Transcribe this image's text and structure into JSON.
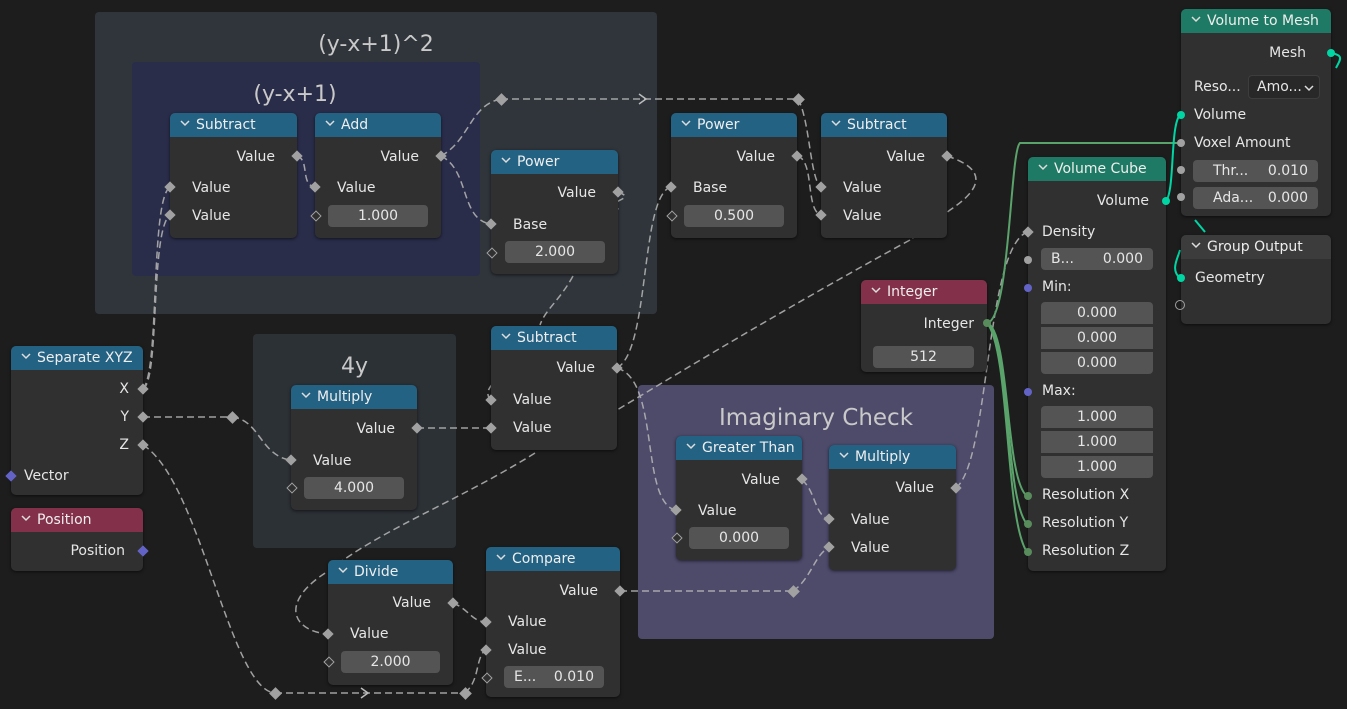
{
  "frames": {
    "outer_square": {
      "title": "(y-x+1)^2",
      "color": "#2f353b"
    },
    "inner_linear": {
      "title": "(y-x+1)",
      "color": "#2a2d4a"
    },
    "four_y": {
      "title": "4y",
      "color": "#2c3136"
    },
    "imaginary": {
      "title": "Imaginary Check",
      "color": "#4d4a6a"
    }
  },
  "nodes": {
    "subtract1": {
      "title": "Subtract",
      "out": "Value",
      "in1": "Value",
      "in2": "Value"
    },
    "add": {
      "title": "Add",
      "out": "Value",
      "in1": "Value",
      "in2_value": "1.000"
    },
    "power1": {
      "title": "Power",
      "out": "Value",
      "in1": "Base",
      "in2_value": "2.000"
    },
    "power2": {
      "title": "Power",
      "out": "Value",
      "in1": "Base",
      "in2_value": "0.500"
    },
    "subtract2": {
      "title": "Subtract",
      "out": "Value",
      "in1": "Value",
      "in2": "Value"
    },
    "subtract3": {
      "title": "Subtract",
      "out": "Value",
      "in1": "Value",
      "in2": "Value"
    },
    "multiply1": {
      "title": "Multiply",
      "out": "Value",
      "in1": "Value",
      "in2_value": "4.000"
    },
    "separate_xyz": {
      "title": "Separate XYZ",
      "out_x": "X",
      "out_y": "Y",
      "out_z": "Z",
      "in": "Vector"
    },
    "position": {
      "title": "Position",
      "out": "Position"
    },
    "divide": {
      "title": "Divide",
      "out": "Value",
      "in1": "Value",
      "in2_value": "2.000"
    },
    "compare": {
      "title": "Compare",
      "out": "Value",
      "in1": "Value",
      "in2": "Value",
      "epsilon_label": "E...",
      "epsilon_value": "0.010"
    },
    "greater_than": {
      "title": "Greater Than",
      "out": "Value",
      "in1": "Value",
      "in2_value": "0.000"
    },
    "multiply2": {
      "title": "Multiply",
      "out": "Value",
      "in1": "Value",
      "in2": "Value"
    },
    "integer": {
      "title": "Integer",
      "out": "Integer",
      "value": "512"
    },
    "volume_cube": {
      "title": "Volume Cube",
      "out": "Volume",
      "density": "Density",
      "background_label": "B...",
      "background_value": "0.000",
      "min_label": "Min:",
      "min_values": [
        "0.000",
        "0.000",
        "0.000"
      ],
      "max_label": "Max:",
      "max_values": [
        "1.000",
        "1.000",
        "1.000"
      ],
      "res_x": "Resolution X",
      "res_y": "Resolution Y",
      "res_z": "Resolution Z"
    },
    "volume_to_mesh": {
      "title": "Volume to Mesh",
      "out": "Mesh",
      "resolution_label": "Reso...",
      "resolution_mode": "Amo...",
      "volume": "Volume",
      "voxel_amount": "Voxel Amount",
      "threshold_label": "Thr...",
      "threshold_value": "0.010",
      "adaptivity_label": "Ada...",
      "adaptivity_value": "0.000"
    },
    "group_output": {
      "title": "Group Output",
      "in": "Geometry"
    }
  },
  "colors": {
    "math_header": "#246283",
    "geometry_header": "#1e7a64",
    "input_header": "#83314a",
    "geometry_socket": "#00d6a3",
    "integer_socket": "#598c5c",
    "vector_socket": "#6363c7",
    "float_socket": "#a1a1a1"
  }
}
